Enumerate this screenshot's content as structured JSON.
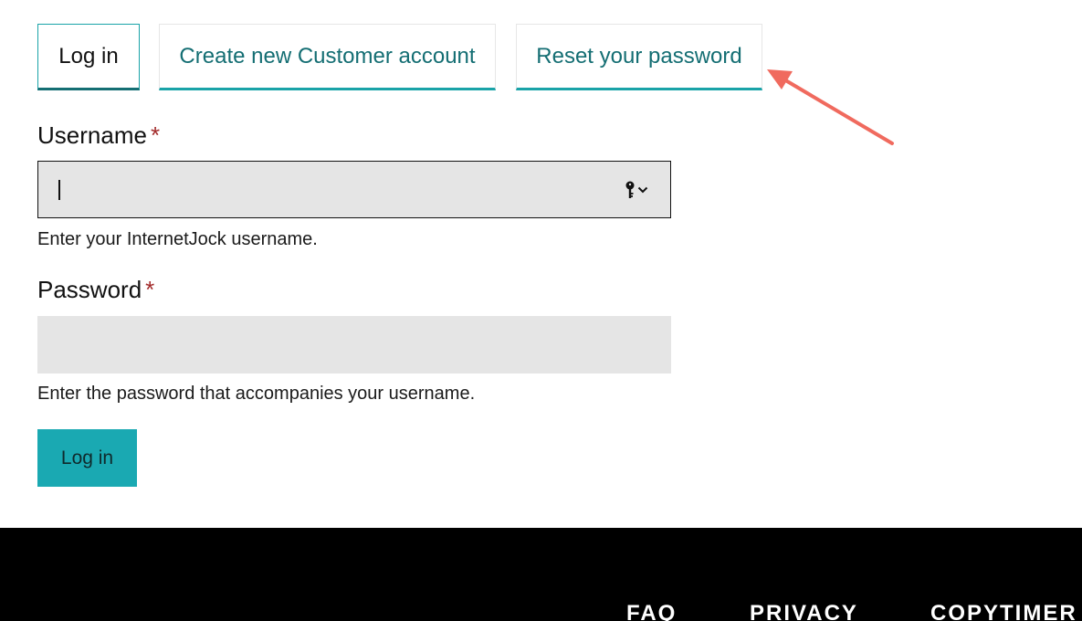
{
  "tabs": [
    {
      "label": "Log in",
      "active": true
    },
    {
      "label": "Create new Customer account",
      "active": false
    },
    {
      "label": "Reset your password",
      "active": false
    }
  ],
  "form": {
    "username": {
      "label": "Username",
      "required_marker": "*",
      "value": "",
      "help": "Enter your InternetJock username."
    },
    "password": {
      "label": "Password",
      "required_marker": "*",
      "value": "",
      "help": "Enter the password that accompanies your username."
    },
    "submit_label": "Log in"
  },
  "icons": {
    "autofill": "key-icon",
    "autofill_menu": "chevron-down-icon"
  },
  "annotation": {
    "type": "arrow",
    "points_to": "Reset your password",
    "color": "#f06a5e"
  },
  "footer": {
    "links": [
      "FAQ",
      "PRIVACY",
      "COPYTIMER"
    ]
  },
  "colors": {
    "accent": "#1aa3a8",
    "tab_text": "#146e73",
    "button_bg": "#1aa9b2",
    "required": "#a22a2a",
    "input_bg": "#e5e5e5",
    "footer_bg": "#000000"
  }
}
